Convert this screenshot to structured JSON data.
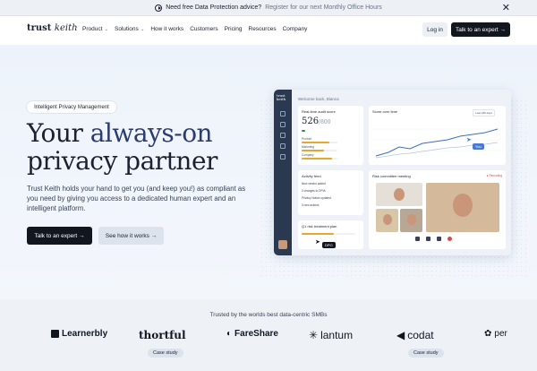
{
  "announcement": {
    "lead": "Need free Data Protection advice?",
    "link": "Register for our next Monthly Office Hours",
    "close": "✕"
  },
  "nav": {
    "logo_bold": "trust",
    "logo_script": "keith",
    "items": [
      "Product",
      "Solutions",
      "How it works",
      "Customers",
      "Pricing",
      "Resources",
      "Company"
    ],
    "login": "Log in",
    "cta": "Talk to an expert →"
  },
  "hero": {
    "pill": "Intelligent Privacy Management",
    "title_1": "Your ",
    "title_accent": "always-on",
    "title_2": "privacy partner",
    "subtitle": "Trust Keith holds your hand to get you (and keep you!) as compliant as you need by giving you access to a dedicated human expert and an intelligent platform.",
    "cta_primary": "Talk to an expert →",
    "cta_secondary": "See how it works →"
  },
  "dashboard": {
    "welcome": "Welcome back, Bianca",
    "audit_title": "Real-time audit score",
    "score": "526",
    "score_max": "/800",
    "bars": [
      {
        "label": "Product",
        "value": 0.78
      },
      {
        "label": "Marketing",
        "value": 0.62
      },
      {
        "label": "Company",
        "value": 0.86
      }
    ],
    "chart_title": "Score over time",
    "chart_range": "Last 180 days",
    "activity_title": "Activity feed",
    "activity_rows": [
      "New vendor added",
      "3 changes to DPIA",
      "Privacy Notice updated",
      "3 new actions"
    ],
    "plan_title": "Q1 risk treatment plan",
    "meeting_title": "Risk committee meeting",
    "recording": "● Recording",
    "dpo_tag": "DPO",
    "you_tag": "You"
  },
  "trusted": {
    "title": "Trusted by the worlds best data-centric SMBs",
    "brands": [
      "Learnerbly",
      "thortful",
      "FareShare",
      "lantum",
      "codat",
      "per"
    ],
    "case_study": "Case study"
  }
}
